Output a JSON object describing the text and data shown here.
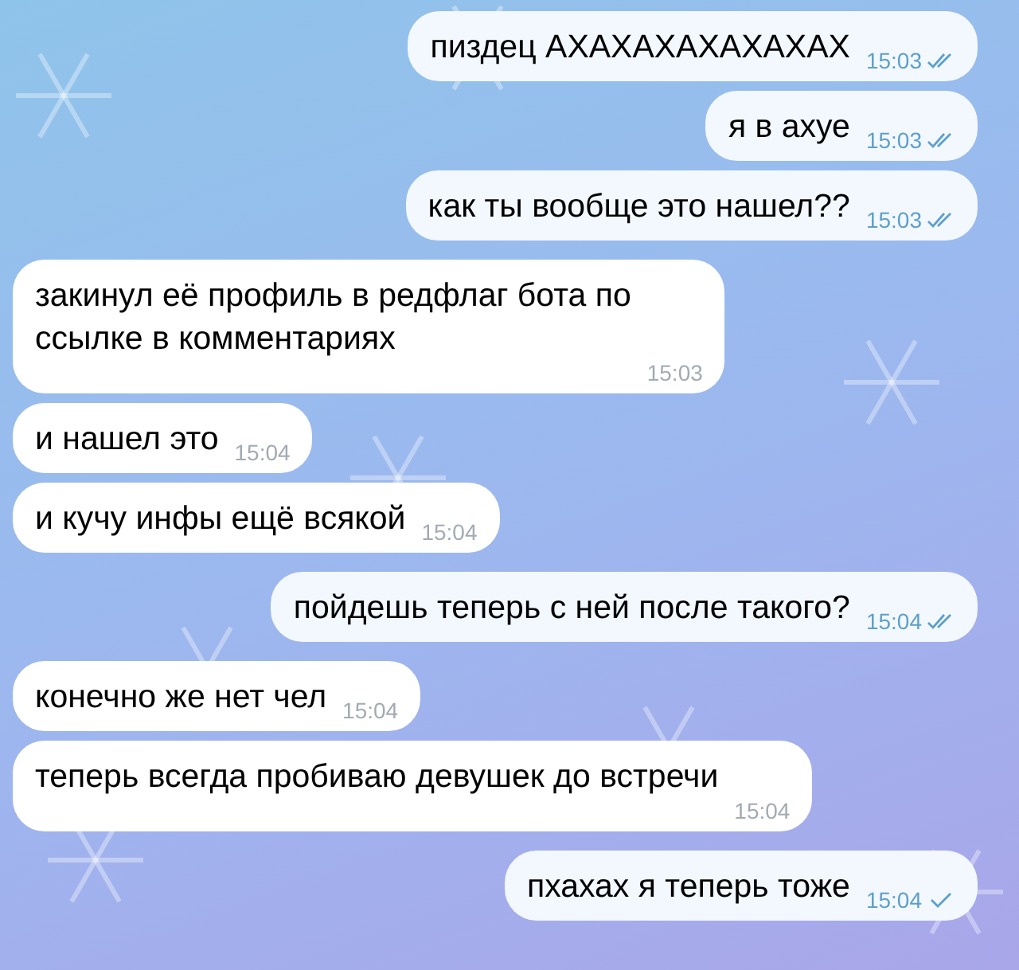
{
  "messages": [
    {
      "outgoing": true,
      "lines": [
        "пиздец АХАХАХАХАХАХАХ"
      ],
      "time": "15:03",
      "read": true
    },
    {
      "outgoing": true,
      "lines": [
        "я в ахуе"
      ],
      "time": "15:03",
      "read": true
    },
    {
      "outgoing": true,
      "lines": [
        "как ты вообще это нашел??"
      ],
      "time": "15:03",
      "read": true
    },
    {
      "outgoing": false,
      "lines": [
        "закинул её профиль в редфлаг бота по",
        "ссылке в комментариях"
      ],
      "time": "15:03"
    },
    {
      "outgoing": false,
      "lines": [
        "и нашел это"
      ],
      "time": "15:04"
    },
    {
      "outgoing": false,
      "lines": [
        "и кучу инфы ещё всякой"
      ],
      "time": "15:04"
    },
    {
      "outgoing": true,
      "lines": [
        "пойдешь теперь с ней после такого?"
      ],
      "time": "15:04",
      "read": true
    },
    {
      "outgoing": false,
      "lines": [
        "конечно же нет чел"
      ],
      "time": "15:04"
    },
    {
      "outgoing": false,
      "lines": [
        "теперь всегда пробиваю девушек до встречи"
      ],
      "time": "15:04",
      "wrap_time": true
    },
    {
      "outgoing": true,
      "lines": [
        "пхахах я теперь тоже"
      ],
      "time": "15:04",
      "read": false
    }
  ]
}
